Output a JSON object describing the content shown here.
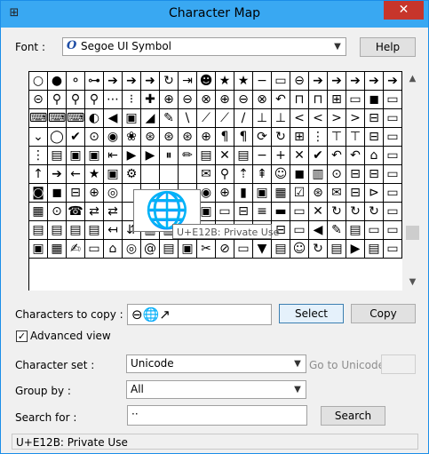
{
  "window": {
    "title": "Character Map",
    "close_glyph": "✕",
    "icon_glyph": "⊞"
  },
  "font_row": {
    "label": "Font :",
    "font_icon": "O",
    "font_name": "Segoe UI Symbol",
    "help_label": "Help"
  },
  "grid": {
    "rows": [
      [
        "○",
        "●",
        "⚬",
        "⊶",
        "➔",
        "➔",
        "➜",
        "↻",
        "⇥",
        "☻",
        "★",
        "★",
        "−",
        "▭",
        "⊖",
        "➔",
        "➔",
        "➔",
        "➔",
        "➔"
      ],
      [
        "⊝",
        "⚲",
        "⚲",
        "⚲",
        "⋯",
        "⁝",
        "✚",
        "⊕",
        "⊖",
        "⊗",
        "⊕",
        "⊖",
        "⊗",
        "↶",
        "⊓",
        "⊓",
        "⊞",
        "▭",
        "◼",
        "▭"
      ],
      [
        "⌨",
        "⌨",
        "⌨",
        "◐",
        "◀",
        "▣",
        "◢",
        "✎",
        "\\",
        "⟋",
        "⟋",
        "/",
        "⊥",
        "⊥",
        "<",
        "<",
        ">",
        ">",
        "⊟",
        "▭"
      ],
      [
        "⌄",
        "◯",
        "✔",
        "⊙",
        "◉",
        "❀",
        "⊛",
        "⊛",
        "⊛",
        "⊕",
        "¶",
        "¶",
        "⟳",
        "↻",
        "⊞",
        "⋮",
        "⊤",
        "⊤",
        "⊟",
        "▭"
      ],
      [
        "⋮",
        "▤",
        "▣",
        "▣",
        "⇤",
        "▶",
        "▶",
        "⏸",
        "✏",
        "▤",
        "✕",
        "▤",
        "−",
        "+",
        "✕",
        "✔",
        "↶",
        "↶",
        "⌂",
        "▭"
      ],
      [
        "↑",
        "➔",
        "←",
        "★",
        "▣",
        "⚙",
        "",
        "",
        "",
        "✉",
        "⚲",
        "⇡",
        "⇞",
        "☺",
        "◼",
        "▥",
        "⊙",
        "⊟",
        "⊟",
        "▭"
      ],
      [
        "◙",
        "◼",
        "⊟",
        "⊕",
        "◎",
        "",
        "",
        "",
        "",
        "◉",
        "⊕",
        "▮",
        "▣",
        "▦",
        "☑",
        "⊛",
        "✉",
        "⊟",
        "⊳",
        "▭"
      ],
      [
        "▦",
        "⊙",
        "☎",
        "⇄",
        "⇄",
        "",
        "",
        "",
        "",
        "▣",
        "▭",
        "⊟",
        "≡",
        "▬",
        "▭",
        "✕",
        "↻",
        "↻",
        "↻",
        "▭"
      ],
      [
        "▤",
        "▤",
        "▤",
        "▤",
        "↤",
        "⇵",
        "▥",
        "▥",
        "▤",
        "▥",
        "⊟",
        "▥",
        "⇣",
        "⊟",
        "▭",
        "◀",
        "✎",
        "▤",
        "▭",
        "▭"
      ],
      [
        "▣",
        "▦",
        "✍",
        "▭",
        "⌂",
        "◎",
        "@",
        "▤",
        "▣",
        "✂",
        "⊘",
        "▭",
        "▼",
        "▤",
        "☺",
        "↻",
        "▤",
        "▶",
        "▤",
        "▭"
      ]
    ],
    "magnified_char": "🌐",
    "tooltip": "U+E12B: Private Use"
  },
  "copy_row": {
    "label": "Characters to copy :",
    "value": "⊖🌐↗",
    "select_label": "Select",
    "copy_label": "Copy"
  },
  "advanced_view": {
    "label": "Advanced view",
    "checked": true,
    "check_glyph": "✓"
  },
  "character_set": {
    "label": "Character set :",
    "value": "Unicode",
    "goto_label": "Go to Unicode :",
    "goto_value": ""
  },
  "group_by": {
    "label": "Group by :",
    "value": "All"
  },
  "search": {
    "label": "Search for :",
    "value": "··",
    "button_label": "Search"
  },
  "status_bar": {
    "text": "U+E12B: Private Use"
  },
  "scrollbar": {
    "up_glyph": "▲",
    "down_glyph": "▼",
    "position_fraction": 0.8
  },
  "combo_arrow_glyph": "▼"
}
